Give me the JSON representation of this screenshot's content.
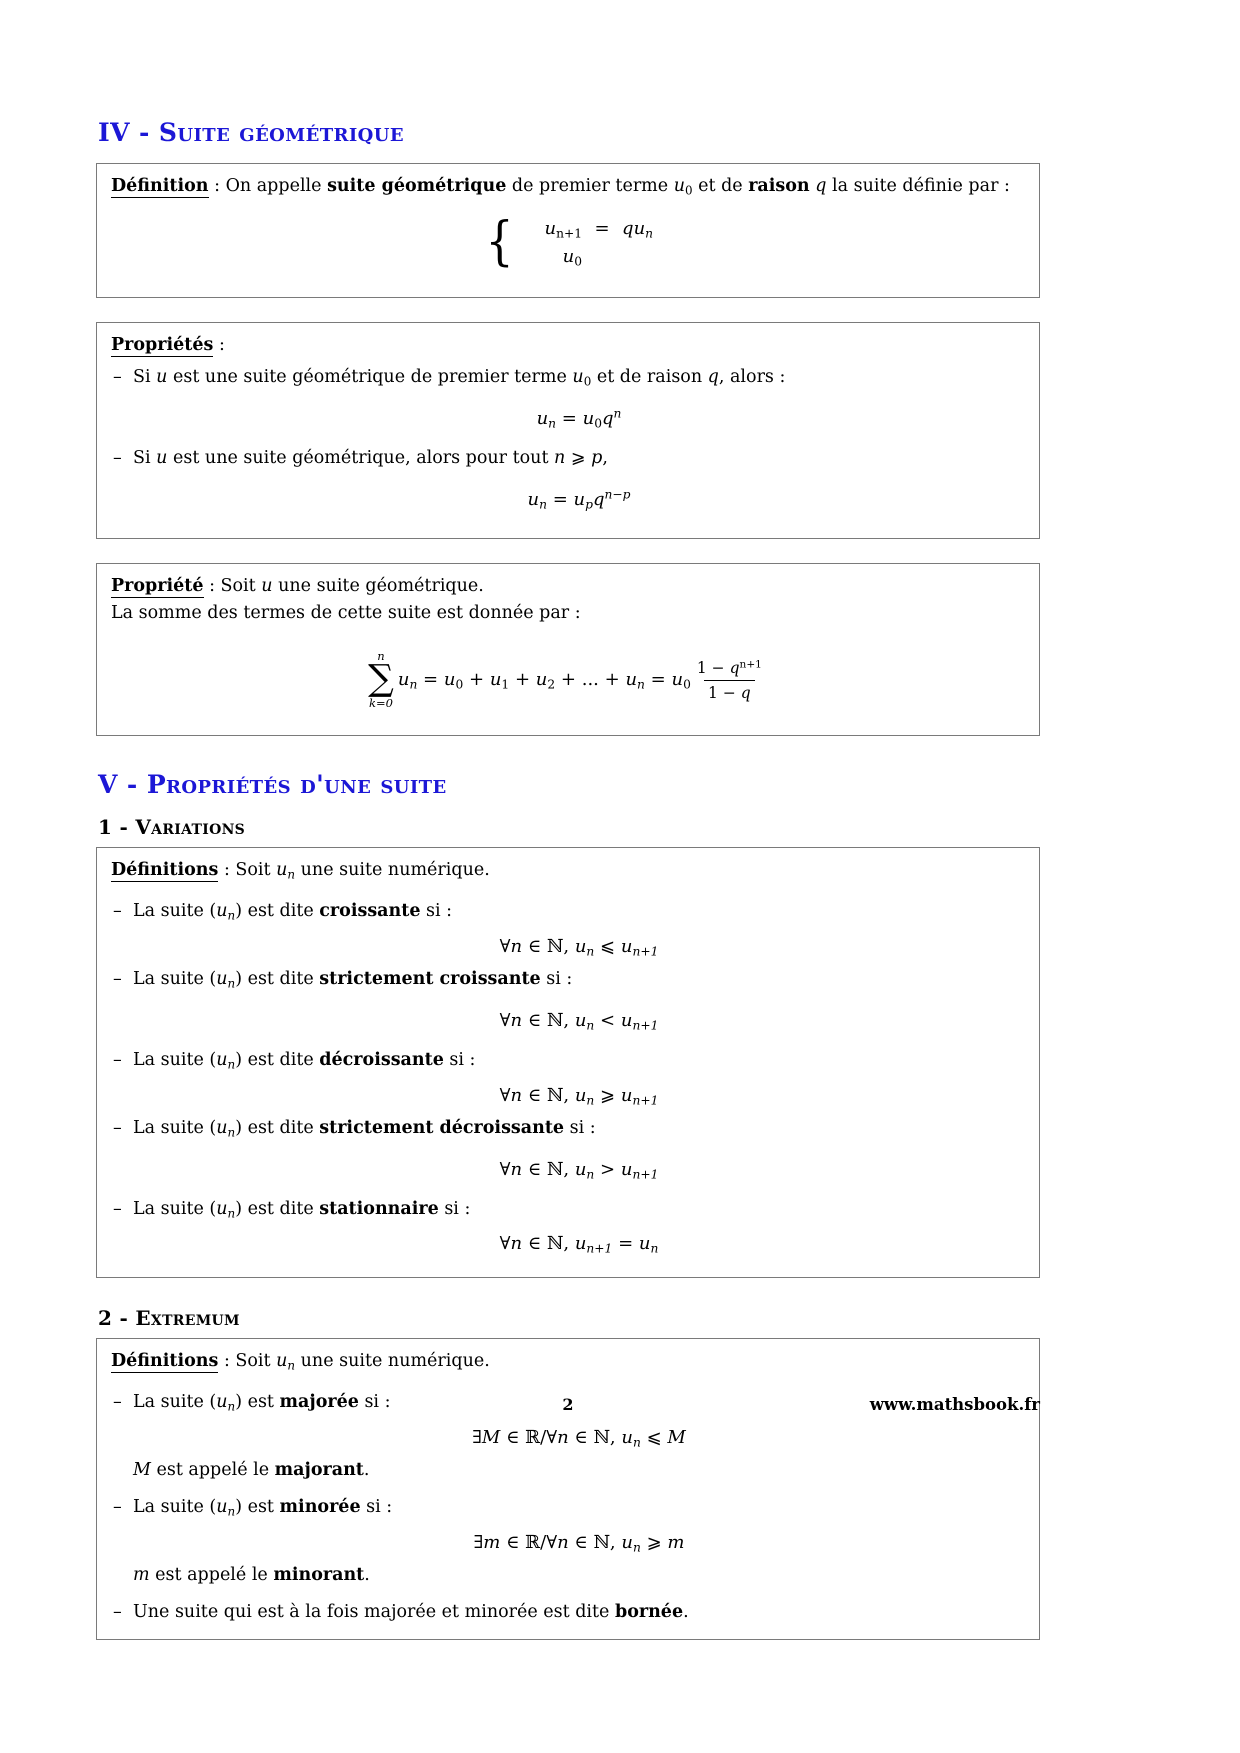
{
  "document": {
    "title": "Suites numériques - cours",
    "heading_color": "#1c17d6"
  },
  "sections": [
    {
      "number": "IV",
      "separator": "-",
      "title": "Suite géométrique"
    },
    {
      "number": "V",
      "separator": "-",
      "title": "Propriétés d'une suite"
    }
  ],
  "subsections": [
    {
      "number": "1",
      "separator": "-",
      "title": "Variations"
    },
    {
      "number": "2",
      "separator": "-",
      "title": "Extremum"
    }
  ],
  "box_definition_geom": {
    "keyword": "Définition",
    "lead_after_keyword": " : On appelle ",
    "bold_1": "suite géométrique",
    "text_1": " de premier terme ",
    "math_u0": "u",
    "math_u0_sub": "0",
    "text_2": " et de ",
    "bold_2": "raison",
    "math_q": "q",
    "text_3": " la suite définie par :",
    "system": {
      "row1_lhs": "u",
      "row1_lhs_sub": "n+1",
      "row1_eq": "=",
      "row1_rhs_q": "q",
      "row1_rhs_u": "u",
      "row1_rhs_sub": "n",
      "row2_lhs": "u",
      "row2_lhs_sub": "0"
    }
  },
  "box_proprietes_geom": {
    "keyword": "Propriétés",
    "colon": " :",
    "items": [
      {
        "text_before": "Si ",
        "var_u": "u",
        "text_mid": " est une suite géométrique de premier terme ",
        "var_u0": "u",
        "var_u0_sub": "0",
        "text_mid2": " et de raison ",
        "var_q": "q",
        "text_after": ", alors :",
        "formula_plain": "u_n = u_0 q^n"
      },
      {
        "text_before": "Si ",
        "var_u": "u",
        "text_mid": " est une suite géométrique, alors pour tout ",
        "var_n": "n",
        "op_ge": "⩾",
        "var_p": "p",
        "text_after": ",",
        "formula_plain": "u_n = u_p q^(n-p)"
      }
    ]
  },
  "box_propriete_somme": {
    "keyword": "Propriété",
    "lead_after_keyword": " : Soit ",
    "var_u": "u",
    "lead_tail": " une suite géométrique.",
    "line2": "La somme des termes de cette suite est donnée par :",
    "sum": {
      "upper_limit": "n",
      "lower_limit": "k=0",
      "sigma": "∑",
      "body": "u",
      "body_sub": "n",
      "equals": "=",
      "expansion": "u_0 + u_1 + u_2 + ... + u_n",
      "terms": [
        "u0",
        "u1",
        "u2",
        "...",
        "un"
      ],
      "result_coef": "u",
      "result_coef_sub": "0",
      "fraction_numerator": "1 − q^(n+1)",
      "fraction_denominator": "1 − q"
    }
  },
  "box_variations": {
    "keyword": "Définitions",
    "lead": " : Soit ",
    "var_un": "u",
    "var_un_sub": "n",
    "lead_tail": " une suite numérique.",
    "items": [
      {
        "prefix": "La suite (",
        "var": "u",
        "var_sub": "n",
        "mid": ") est dite ",
        "bold": "croissante",
        "suffix": " si :",
        "formula": "∀n ∈ ℕ, u_n ⩽ u_{n+1}",
        "relation": "⩽"
      },
      {
        "prefix": "La suite (",
        "var": "u",
        "var_sub": "n",
        "mid": ") est dite ",
        "bold": "strictement croissante",
        "suffix": " si :",
        "formula": "∀n ∈ ℕ, u_n < u_{n+1}",
        "relation": "<"
      },
      {
        "prefix": "La suite (",
        "var": "u",
        "var_sub": "n",
        "mid": ") est dite ",
        "bold": "décroissante",
        "suffix": " si :",
        "formula": "∀n ∈ ℕ, u_n ⩾ u_{n+1}",
        "relation": "⩾"
      },
      {
        "prefix": "La suite (",
        "var": "u",
        "var_sub": "n",
        "mid": ") est dite ",
        "bold": "strictement décroissante",
        "suffix": " si :",
        "formula": "∀n ∈ ℕ, u_n > u_{n+1}",
        "relation": ">"
      },
      {
        "prefix": "La suite (",
        "var": "u",
        "var_sub": "n",
        "mid": ") est dite ",
        "bold": "stationnaire",
        "suffix": " si :",
        "formula": "∀n ∈ ℕ, u_{n+1} = u_n",
        "relation": "="
      }
    ],
    "symbols": {
      "forall": "∀",
      "in": "∈",
      "naturals": "ℕ",
      "reals": "ℝ",
      "exists": "∃"
    }
  },
  "box_extremum": {
    "keyword": "Définitions",
    "lead": " : Soit ",
    "var_un": "u",
    "var_un_sub": "n",
    "lead_tail": " une suite numérique.",
    "item1": {
      "prefix": "La suite (",
      "var": "u",
      "var_sub": "n",
      "mid": ") est ",
      "bold": "majorée",
      "suffix": " si :",
      "formula": "∃M ∈ ℝ/∀n ∈ ℕ, u_n ⩽ M",
      "note_var": "M",
      "note_text": " est appelé le ",
      "note_bold": "majorant",
      "note_end": "."
    },
    "item2": {
      "prefix": "La suite (",
      "var": "u",
      "var_sub": "n",
      "mid": ") est ",
      "bold": "minorée",
      "suffix": " si :",
      "formula": "∃m ∈ ℝ/∀n ∈ ℕ, u_n ⩾ m",
      "note_var": "m",
      "note_text": " est appelé le ",
      "note_bold": "minorant",
      "note_end": "."
    },
    "item3": {
      "text_before": "Une suite qui est à la fois majorée et minorée est dite ",
      "bold": "bornée",
      "text_after": "."
    }
  },
  "footer": {
    "page_number": "2",
    "website": "www.mathsbook.fr"
  }
}
